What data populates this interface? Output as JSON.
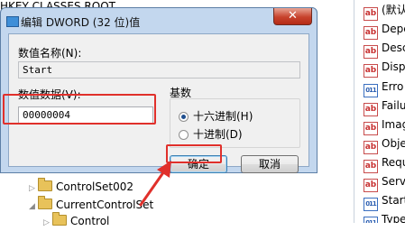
{
  "background_tree": {
    "items": [
      {
        "label": "HKEY CLASSES ROOT",
        "expanded": false
      },
      {
        "label": "ControlSet002",
        "expanded": false
      },
      {
        "label": "CurrentControlSet",
        "expanded": true
      },
      {
        "label": "Control",
        "expanded": false
      }
    ]
  },
  "values_list": {
    "items": [
      {
        "icon": "ab",
        "name": "(默认)"
      },
      {
        "icon": "ab",
        "name": "Depe"
      },
      {
        "icon": "ab",
        "name": "Desc"
      },
      {
        "icon": "ab",
        "name": "Disp"
      },
      {
        "icon": "bin",
        "name": "Erro"
      },
      {
        "icon": "ab",
        "name": "Failu"
      },
      {
        "icon": "ab",
        "name": "Imag"
      },
      {
        "icon": "ab",
        "name": "Obje"
      },
      {
        "icon": "ab",
        "name": "Requ"
      },
      {
        "icon": "ab",
        "name": "Serv"
      },
      {
        "icon": "bin",
        "name": "Start"
      },
      {
        "icon": "bin",
        "name": "Type"
      }
    ]
  },
  "dialog": {
    "title": "编辑 DWORD (32 位)值",
    "close_label": "✕",
    "value_name_label": "数值名称(N):",
    "value_name": "Start",
    "value_data_label": "数值数据(V):",
    "value_data": "00000004",
    "base_label": "基数",
    "radix_options": [
      {
        "label": "十六进制(H)",
        "selected": true
      },
      {
        "label": "十进制(D)",
        "selected": false
      }
    ],
    "ok_label": "确定",
    "cancel_label": "取消"
  },
  "colors": {
    "highlight": "#e0302b",
    "dialog_frame": "#c3d7ee"
  }
}
